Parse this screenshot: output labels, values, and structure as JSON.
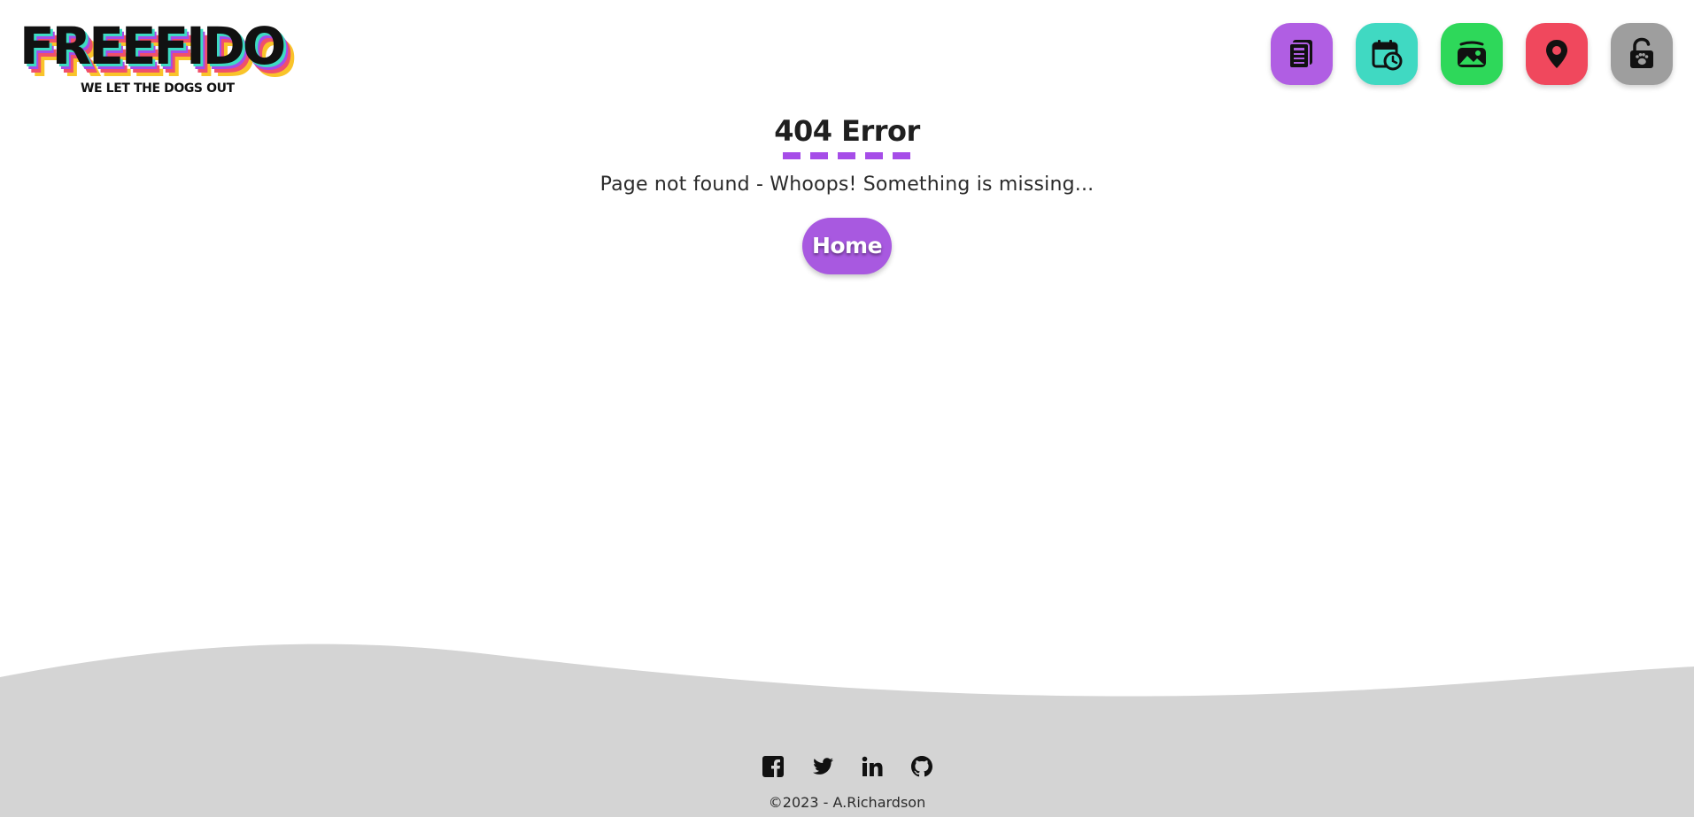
{
  "header": {
    "logo": {
      "wordmark": "FREEFIDO",
      "tagline": "WE LET THE DOGS OUT",
      "colors": [
        "#111111",
        "#3ddbc3",
        "#a74be8",
        "#f0506a",
        "#f9c42a",
        "#33d65a"
      ]
    },
    "nav": [
      {
        "icon": "newspaper-icon",
        "color": "#b05ee3"
      },
      {
        "icon": "calendar-clock-icon",
        "color": "#40d9c2"
      },
      {
        "icon": "photo-gallery-icon",
        "color": "#2ed85a"
      },
      {
        "icon": "map-pin-icon",
        "color": "#f0485d"
      },
      {
        "icon": "unlock-paw-icon",
        "color": "#9e9e9e"
      }
    ]
  },
  "main": {
    "title": "404 Error",
    "subtitle": "Page not found - Whoops! Something is missing...",
    "home_label": "Home",
    "accent": "#a64de8"
  },
  "footer": {
    "background": "#d4d4d4",
    "social": [
      {
        "icon": "facebook-icon"
      },
      {
        "icon": "twitter-icon"
      },
      {
        "icon": "linkedin-icon"
      },
      {
        "icon": "github-icon"
      }
    ],
    "copyright": "©2023 - A.Richardson"
  }
}
